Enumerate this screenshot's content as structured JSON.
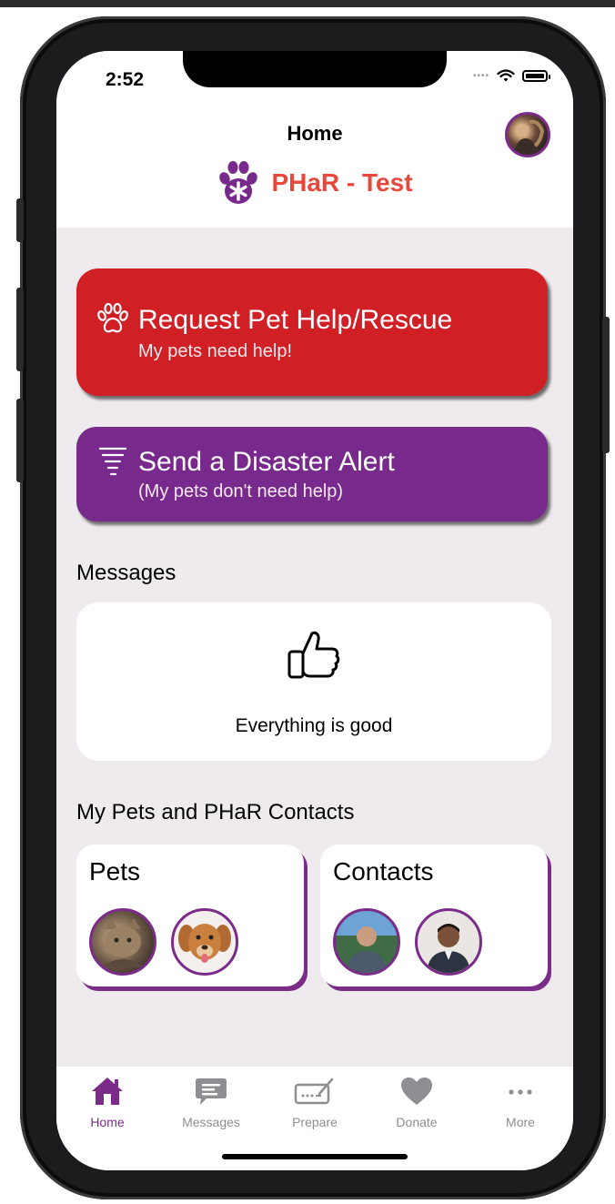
{
  "status": {
    "time": "2:52"
  },
  "header": {
    "title": "Home",
    "brand": "PHaR - Test"
  },
  "actions": {
    "request": {
      "title": "Request Pet Help/Rescue",
      "subtitle": "My pets need help!"
    },
    "alert": {
      "title": "Send a Disaster Alert",
      "subtitle": "(My pets don't need help)"
    }
  },
  "messages": {
    "section_title": "Messages",
    "status_text": "Everything is good"
  },
  "contacts_section": {
    "section_title": "My Pets and PHaR Contacts",
    "pets_title": "Pets",
    "contacts_title": "Contacts"
  },
  "tabs": [
    {
      "label": "Home",
      "icon": "house-icon",
      "active": true
    },
    {
      "label": "Messages",
      "icon": "chat-bubble-icon",
      "active": false
    },
    {
      "label": "Prepare",
      "icon": "signature-icon",
      "active": false
    },
    {
      "label": "Donate",
      "icon": "heart-icon",
      "active": false
    },
    {
      "label": "More",
      "icon": "ellipsis-icon",
      "active": false
    }
  ],
  "colors": {
    "brand_red": "#d01f25",
    "brand_purple": "#772a8b",
    "brand_text": "#e8483c",
    "inactive_tab": "#8e8e93"
  }
}
